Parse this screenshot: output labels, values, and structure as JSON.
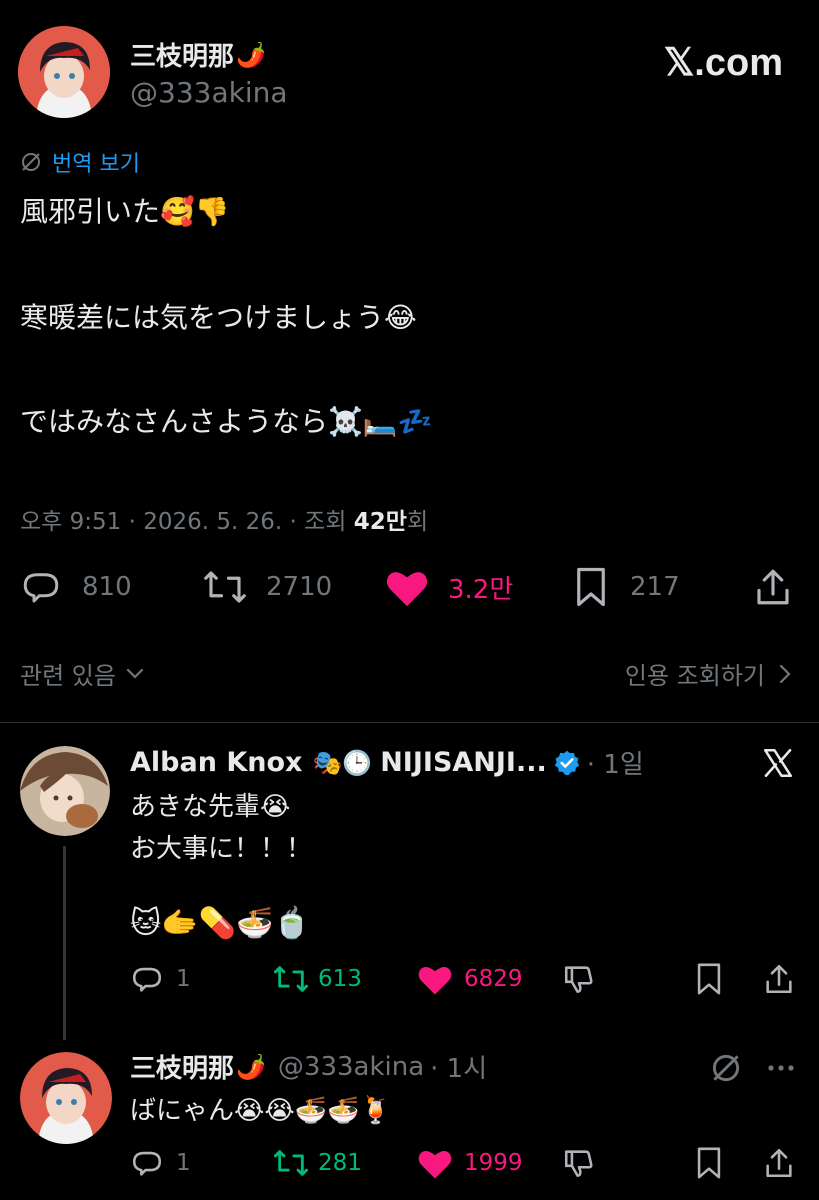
{
  "header": {
    "display_name": "三枝明那",
    "name_emoji": "🌶️",
    "handle": "@333akina",
    "site_logo": "𝕏.com"
  },
  "tweet": {
    "translate_label": "번역 보기",
    "lines": [
      "風邪引いた🥰👎",
      "寒暖差には気をつけましょう😂",
      "ではみなさんさようなら☠️🛏️💤"
    ],
    "timestamp": "오후 9:51 · 2026. 5. 26. · 조회 ",
    "views_value": "42만",
    "views_suffix": "회",
    "stats": {
      "replies": "810",
      "retweets": "2710",
      "likes": "3.2만",
      "bookmarks": "217"
    },
    "related_label": "관련 있음",
    "quotes_label": "인용 조회하기"
  },
  "reply1": {
    "display_name": "Alban Knox",
    "name_emoji": "🎭🕒",
    "affiliation": "NIJISANJI...",
    "time": "· 1일",
    "lines": [
      "あきな先輩😭",
      "お大事に！！！"
    ],
    "emoji_line": "🐱🫱💊🍜🍵",
    "stats": {
      "replies": "1",
      "retweets": "613",
      "likes": "6829"
    }
  },
  "reply2": {
    "display_name": "三枝明那",
    "name_emoji": "🌶️",
    "handle": "@333akina",
    "time": "· 1시",
    "line": "ばにゃん😭😭🍜🍜🍹",
    "stats": {
      "replies": "1",
      "retweets": "281",
      "likes": "1999"
    }
  },
  "colors": {
    "background": "#000000",
    "text": "#e7e9ea",
    "muted": "#71767b",
    "like": "#f91880",
    "retweet": "#00ba7c",
    "link": "#1d9bf0"
  }
}
